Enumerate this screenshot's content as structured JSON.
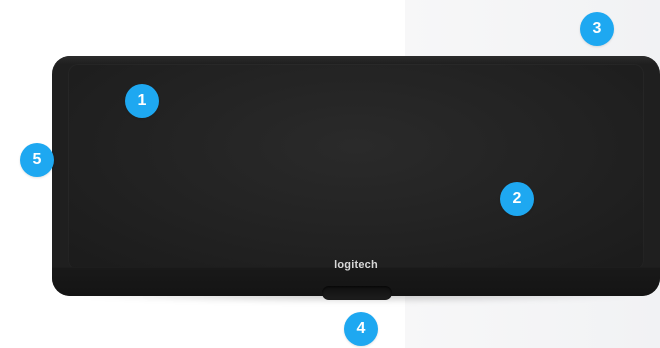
{
  "brand": {
    "logo_text": "logitech"
  },
  "callouts": [
    {
      "label": "1"
    },
    {
      "label": "2"
    },
    {
      "label": "3"
    },
    {
      "label": "4"
    },
    {
      "label": "5"
    }
  ],
  "colors": {
    "callout": "#1ea8f1",
    "device": "#1f1f1f",
    "background_right": "#f3f4f6"
  }
}
